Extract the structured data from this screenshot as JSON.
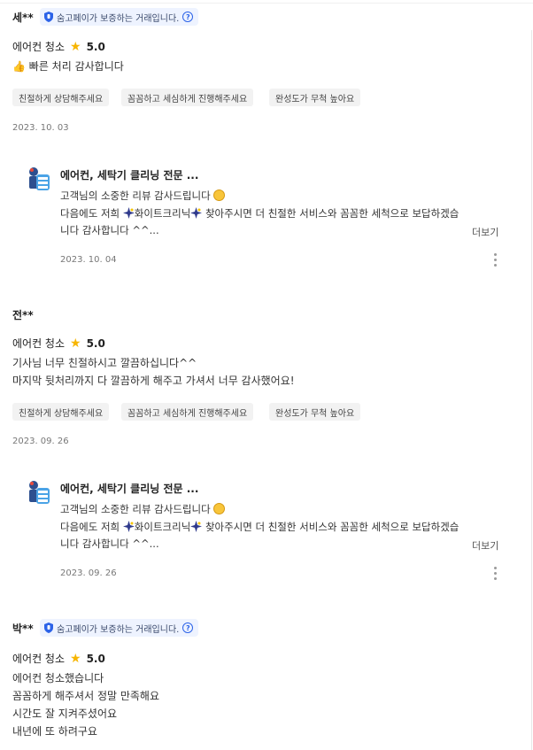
{
  "badge_text": "숨고페이가 보증하는 거래입니다.",
  "reviews": [
    {
      "author": "세**",
      "service": "에어컨 청소",
      "score": "5.0",
      "lines": [
        "빠른 처리 감사합니다"
      ],
      "tags": [
        "친절하게 상담해주세요",
        "꼼꼼하고 세심하게 진행해주세요",
        "완성도가 무척 높아요"
      ],
      "date": "2023. 10. 03",
      "reply": {
        "name": "에어컨, 세탁기 클리닝 전문 ...",
        "line1": "고객님의 소중한 리뷰 감사드립니다",
        "line2a": "다음에도 저희",
        "line2b": "화이트크리닉",
        "line2c": "찾아주시면 더 친절한 서비스와 꼼꼼한 세척으로 보답하겠습",
        "line3": "니다 감사합니다 ^^...",
        "more": "더보기",
        "date": "2023. 10. 04"
      }
    },
    {
      "author": "전**",
      "service": "에어컨 청소",
      "score": "5.0",
      "lines": [
        "기사님 너무 친절하시고 깔끔하십니다^^",
        "마지막 뒷처리까지 다 깔끔하게 해주고 가셔서 너무 감사했어요!"
      ],
      "tags": [
        "친절하게 상담해주세요",
        "꼼꼼하고 세심하게 진행해주세요",
        "완성도가 무척 높아요"
      ],
      "date": "2023. 09. 26",
      "reply": {
        "name": "에어컨, 세탁기 클리닝 전문 ...",
        "line1": "고객님의 소중한 리뷰 감사드립니다",
        "line2a": "다음에도 저희",
        "line2b": "화이트크리닉",
        "line2c": "찾아주시면 더 친절한 서비스와 꼼꼼한 세척으로 보답하겠습",
        "line3": "니다 감사합니다 ^^...",
        "more": "더보기",
        "date": "2023. 09. 26"
      }
    },
    {
      "author": "박**",
      "service": "에어컨 청소",
      "score": "5.0",
      "lines": [
        "에어컨 청소했습니다",
        "꼼꼼하게 해주셔서 정말 만족해요",
        "시간도 잘 지켜주셨어요",
        "내년에 또 하려구요"
      ]
    }
  ],
  "colors": {
    "accent": "#2c63e8",
    "star": "#f7b500",
    "badge_bg": "#eef3ff",
    "tag_bg": "#f2f2f2"
  },
  "icons": [
    "shield-icon",
    "help-circle-icon",
    "star-icon",
    "thumbs-up-icon",
    "smile-emoji-icon",
    "sparkle-icon",
    "more-vertical-icon",
    "avatar-logo"
  ]
}
